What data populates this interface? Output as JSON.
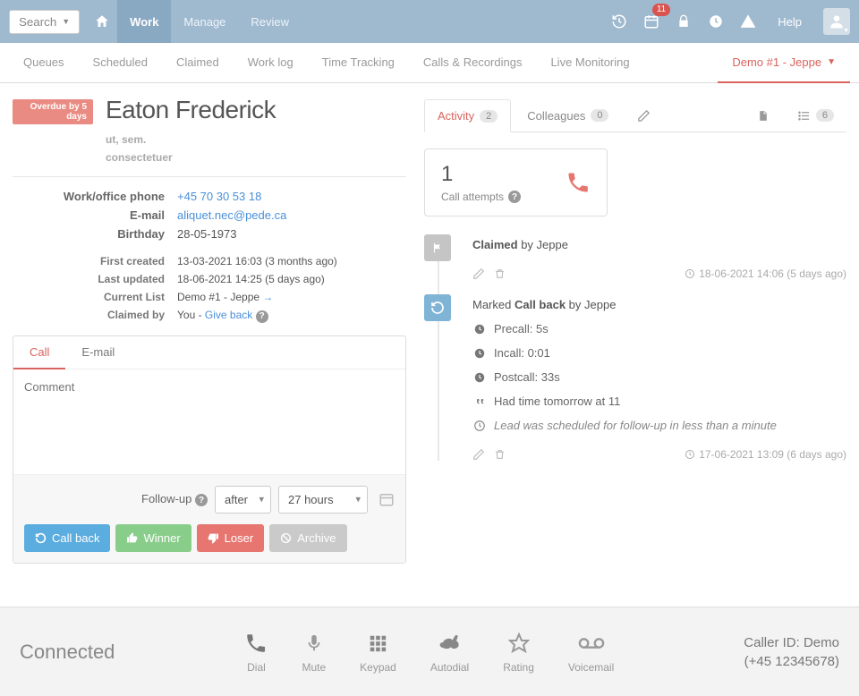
{
  "topbar": {
    "search_label": "Search",
    "nav": [
      "Work",
      "Manage",
      "Review"
    ],
    "active_nav": "Work",
    "calendar_badge": "11",
    "help_label": "Help"
  },
  "subnav": {
    "items": [
      "Queues",
      "Scheduled",
      "Claimed",
      "Work log",
      "Time Tracking",
      "Calls & Recordings",
      "Live Monitoring"
    ],
    "active_item": "Demo #1 - Jeppe"
  },
  "lead": {
    "overdue_text": "Overdue by 5 days",
    "name": "Eaton Frederick",
    "sub1": "ut, sem.",
    "sub2": "consectetuer",
    "phone_label": "Work/office phone",
    "phone": "+45 70 30 53 18",
    "email_label": "E-mail",
    "email": "aliquet.nec@pede.ca",
    "birthday_label": "Birthday",
    "birthday": "28-05-1973",
    "first_created_label": "First created",
    "first_created": "13-03-2021 16:03 (3 months ago)",
    "last_updated_label": "Last updated",
    "last_updated": "18-06-2021 14:25 (5 days ago)",
    "current_list_label": "Current List",
    "current_list": "Demo #1 - Jeppe",
    "claimed_by_label": "Claimed by",
    "claimed_by_value": "You - ",
    "give_back": "Give back"
  },
  "compose": {
    "tabs": {
      "call": "Call",
      "email": "E-mail"
    },
    "placeholder": "Comment",
    "followup_label": "Follow-up",
    "select_mode": "after",
    "select_duration": "27 hours",
    "btn_callback": "Call back",
    "btn_winner": "Winner",
    "btn_loser": "Loser",
    "btn_archive": "Archive"
  },
  "right": {
    "tab_activity": "Activity",
    "activity_count": "2",
    "tab_colleagues": "Colleagues",
    "colleagues_count": "0",
    "list_count": "6",
    "call_card": {
      "number": "1",
      "label": "Call attempts"
    }
  },
  "timeline": [
    {
      "marker": "flag",
      "title_prefix": "",
      "title_bold": "Claimed",
      "title_suffix": " by Jeppe",
      "meta": "18-06-2021 14:06 (5 days ago)",
      "details": []
    },
    {
      "marker": "refresh",
      "title_prefix": "Marked ",
      "title_bold": "Call back",
      "title_suffix": " by Jeppe",
      "meta": "17-06-2021 13:09 (6 days ago)",
      "details": [
        {
          "icon": "clock",
          "text": "Precall: 5s"
        },
        {
          "icon": "clock",
          "text": "Incall: 0:01"
        },
        {
          "icon": "clock",
          "text": "Postcall: 33s"
        },
        {
          "icon": "quote",
          "text": "Had time tomorrow at 11"
        },
        {
          "icon": "oclock",
          "text": "Lead was scheduled for follow-up in less than a minute",
          "italic": true
        }
      ]
    }
  ],
  "bottombar": {
    "status": "Connected",
    "btns": {
      "dial": "Dial",
      "mute": "Mute",
      "keypad": "Keypad",
      "autodial": "Autodial",
      "rating": "Rating",
      "voicemail": "Voicemail"
    },
    "callerid_line1": "Caller ID: Demo",
    "callerid_line2": "(+45 12345678)"
  }
}
